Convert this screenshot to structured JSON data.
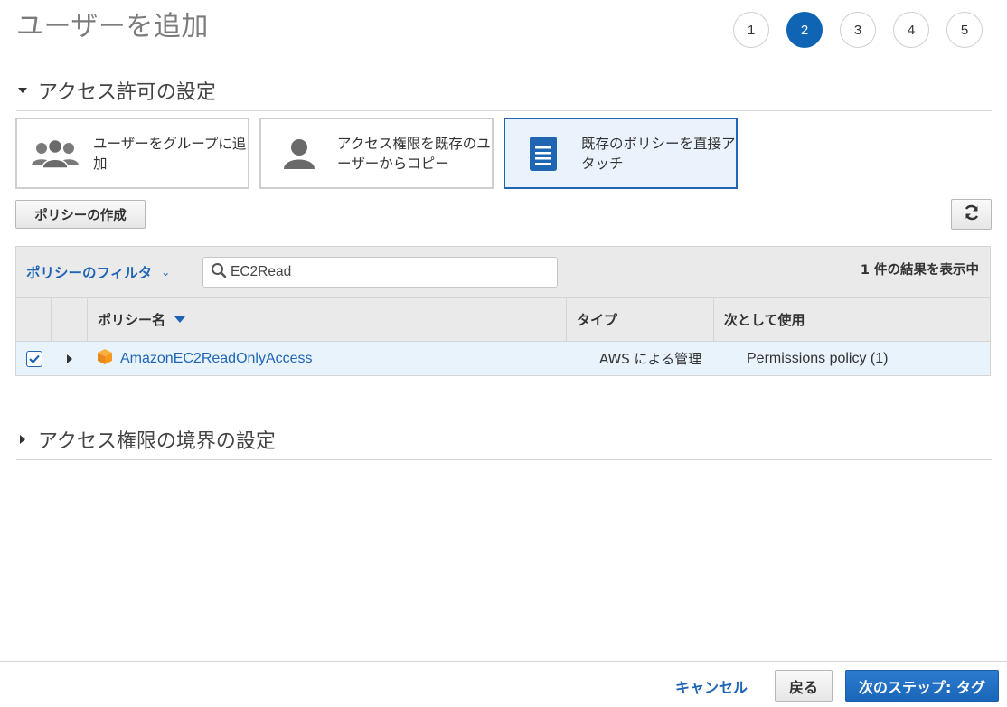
{
  "page": {
    "title": "ユーザーを追加"
  },
  "steps": [
    {
      "label": "1",
      "active": false
    },
    {
      "label": "2",
      "active": true
    },
    {
      "label": "3",
      "active": false
    },
    {
      "label": "4",
      "active": false
    },
    {
      "label": "5",
      "active": false
    }
  ],
  "permissions_section": {
    "title": "アクセス許可の設定",
    "options": [
      {
        "label_line1": "ユーザーをグループに追",
        "label_line2": "加",
        "icon": "group-icon"
      },
      {
        "label_line1": "アクセス権限を既存のユ",
        "label_line2": "ーザーからコピー",
        "icon": "user-icon"
      },
      {
        "label_line1": "既存のポリシーを直接ア",
        "label_line2": "タッチ",
        "icon": "document-icon",
        "selected": true
      }
    ],
    "create_policy_label": "ポリシーの作成",
    "refresh_icon": "refresh-icon"
  },
  "policy_table": {
    "filter_label": "ポリシーのフィルタ",
    "search_value": "EC2Read",
    "result_count": "1 件の結果を表示中",
    "columns": [
      "ポリシー名",
      "タイプ",
      "次として使用"
    ],
    "rows": [
      {
        "checked": true,
        "name": "AmazonEC2ReadOnlyAccess",
        "type": "AWS による管理",
        "used_as": "Permissions policy (1)"
      }
    ]
  },
  "boundary_section": {
    "title": "アクセス権限の境界の設定"
  },
  "footer": {
    "cancel_label": "キャンセル",
    "back_label": "戻る",
    "next_label": "次のステップ: タグ"
  },
  "colors": {
    "accent": "#1f65b4",
    "step_active": "#0f64b4",
    "selected_bg": "#eaf3fc",
    "aws_orange": "#f7981d"
  }
}
